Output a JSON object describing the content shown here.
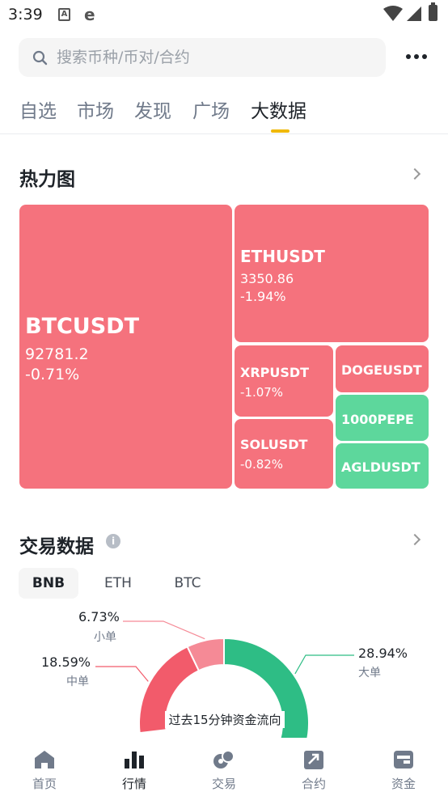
{
  "status_bar": {
    "time": "3:39",
    "app_icon_a": "A",
    "app_icon_e": "e"
  },
  "search": {
    "placeholder": "搜索币种/币对/合约"
  },
  "tabs": [
    {
      "label": "自选"
    },
    {
      "label": "市场"
    },
    {
      "label": "发现"
    },
    {
      "label": "广场"
    },
    {
      "label": "大数据"
    }
  ],
  "heatmap": {
    "title": "热力图",
    "tiles": [
      {
        "symbol": "BTCUSDT",
        "price": "92781.2",
        "change": "-0.71%",
        "trend": "down"
      },
      {
        "symbol": "ETHUSDT",
        "price": "3350.86",
        "change": "-1.94%",
        "trend": "down"
      },
      {
        "symbol": "XRPUSDT",
        "price": "",
        "change": "-1.07%",
        "trend": "down"
      },
      {
        "symbol": "DOGEUSDT",
        "price": "",
        "change": "",
        "trend": "down"
      },
      {
        "symbol": "1000PEPE",
        "price": "",
        "change": "",
        "trend": "up"
      },
      {
        "symbol": "SOLUSDT",
        "price": "",
        "change": "-0.82%",
        "trend": "down"
      },
      {
        "symbol": "AGLDUSDT",
        "price": "",
        "change": "",
        "trend": "up"
      }
    ]
  },
  "trade_data": {
    "title": "交易数据",
    "info_icon": "i",
    "coin_tabs": [
      {
        "label": "BNB"
      },
      {
        "label": "ETH"
      },
      {
        "label": "BTC"
      }
    ],
    "selected_coin": "BNB",
    "chart_data": {
      "type": "pie",
      "title": "过去15分钟资金流向",
      "slices": [
        {
          "label": "小单",
          "value": 6.73,
          "display": "6.73%",
          "color": "#f58a96"
        },
        {
          "label": "中单",
          "value": 18.59,
          "display": "18.59%",
          "color": "#f25b6b"
        },
        {
          "label": "大单",
          "value": 28.94,
          "display": "28.94%",
          "color": "#2ebd85"
        }
      ]
    }
  },
  "colors": {
    "accent": "#f0b90b",
    "down": "#f5727d",
    "up": "#5dd79c"
  },
  "bottom_nav": [
    {
      "label": "首页",
      "icon": "home-icon"
    },
    {
      "label": "行情",
      "icon": "markets-icon"
    },
    {
      "label": "交易",
      "icon": "trade-icon"
    },
    {
      "label": "合约",
      "icon": "futures-icon"
    },
    {
      "label": "资金",
      "icon": "wallet-icon"
    }
  ]
}
